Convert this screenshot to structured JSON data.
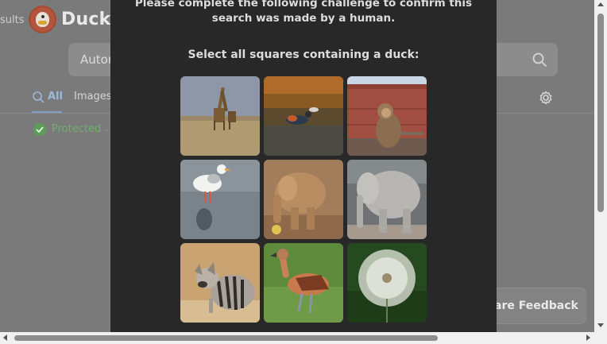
{
  "page": {
    "results_fragment": "sults",
    "brand": "DuckDu",
    "search": {
      "value": "Autor"
    },
    "tabs": [
      {
        "label": "All",
        "active": true
      },
      {
        "label": "Images",
        "active": false
      }
    ],
    "protected_label": "Protected",
    "feedback_label": "are Feedback"
  },
  "modal": {
    "line1": "Please complete the following challenge to confirm this",
    "line2": "search was made by a human.",
    "instruction": "Select all squares containing a duck:",
    "tiles": [
      {
        "icon": "giraffes-image"
      },
      {
        "icon": "duck-in-water-image"
      },
      {
        "icon": "monkey-image"
      },
      {
        "icon": "seagull-image"
      },
      {
        "icon": "baby-elephant-image"
      },
      {
        "icon": "elephant-image"
      },
      {
        "icon": "aardwolf-image"
      },
      {
        "icon": "whistling-duck-image"
      },
      {
        "icon": "dandelion-image"
      }
    ]
  },
  "colors": {
    "overlay": "#7a7a7a",
    "modal_bg": "#282828",
    "accent_blue": "#9cb8dd",
    "protected_green": "#6fae6b"
  }
}
